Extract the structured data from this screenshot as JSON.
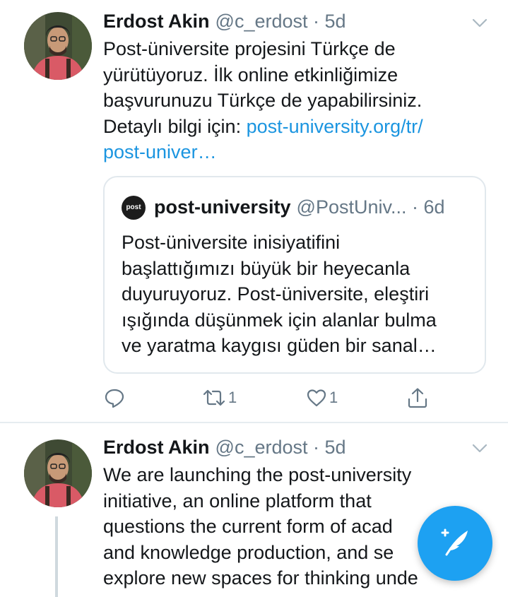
{
  "tweets": [
    {
      "name": "Erdost Akin",
      "handle": "@c_erdost",
      "time": "· 5d",
      "text_lines": [
        "Post-üniversite projesini Türkçe de",
        "yürütüyoruz. İlk online etkinliğimize",
        "başvurunuzu Türkçe de yapabilirsiniz.",
        "Detaylı bilgi için: "
      ],
      "link_part1": "post-university.org/tr/",
      "link_part2": "post-univer…",
      "quoted": {
        "avatar_text": "post",
        "name": "post-university",
        "handle": "@PostUniv...",
        "time": "· 6d",
        "text_lines": [
          "Post-üniversite inisiyatifini",
          "başlattığımızı büyük bir heyecanla",
          "duyuruyoruz. Post-üniversite, eleştiri",
          "ışığında düşünmek için alanlar bulma",
          "ve yaratma kaygısı güden bir sanal…"
        ]
      },
      "actions": {
        "reply_icon": "reply-icon",
        "retweet_icon": "retweet-icon",
        "retweet_count": "1",
        "like_icon": "heart-icon",
        "like_count": "1",
        "share_icon": "share-icon"
      }
    },
    {
      "name": "Erdost Akin",
      "handle": "@c_erdost",
      "time": "· 5d",
      "text_lines": [
        "We are launching the post-university",
        "initiative, an online platform that",
        "questions the current form of acad",
        "and knowledge production, and se",
        "explore new spaces for thinking unde"
      ]
    }
  ],
  "compose_icon": "compose-feather-icon",
  "colors": {
    "link": "#1b95e0",
    "muted": "#657786",
    "accent": "#1da1f2",
    "border": "#e1e8ed"
  }
}
